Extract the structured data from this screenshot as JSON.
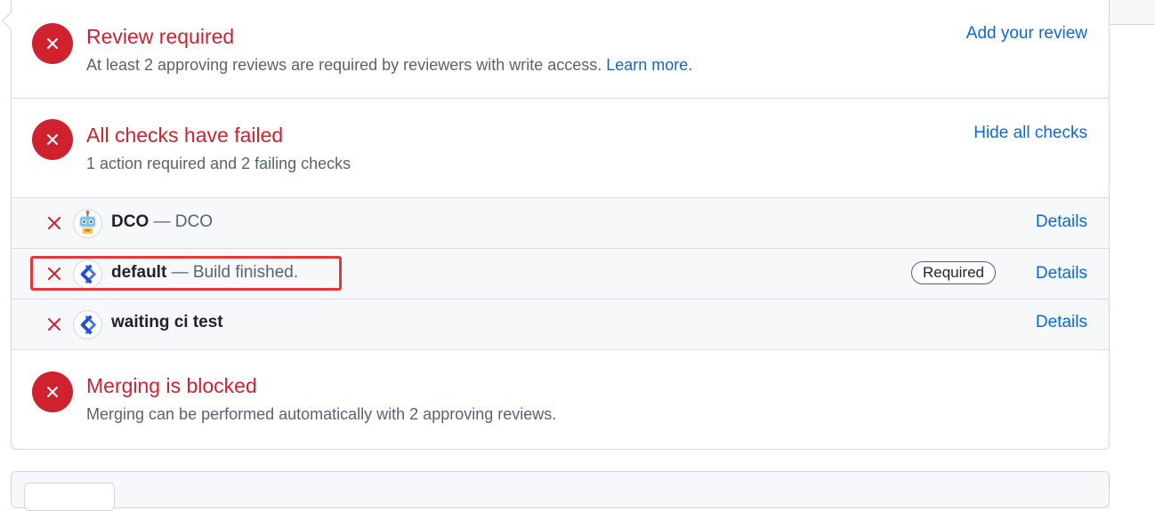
{
  "review": {
    "title": "Review required",
    "subtitle": "At least 2 approving reviews are required by reviewers with write access.",
    "learn_more": "Learn more.",
    "action": "Add your review"
  },
  "checks": {
    "title": "All checks have failed",
    "subtitle": "1 action required and 2 failing checks",
    "action": "Hide all checks",
    "items": [
      {
        "name": "DCO",
        "description": "— DCO",
        "details": "Details",
        "icon": "robot-icon"
      },
      {
        "name": "default",
        "description": "— Build finished.",
        "badge": "Required",
        "details": "Details",
        "icon": "ci-logo-icon",
        "highlighted": true
      },
      {
        "name": "waiting ci test",
        "description": "",
        "details": "Details",
        "icon": "ci-logo-icon"
      }
    ]
  },
  "merge": {
    "title": "Merging is blocked",
    "subtitle": "Merging can be performed automatically with 2 approving reviews."
  },
  "colors": {
    "danger": "#cf222e",
    "link": "#0969da",
    "highlight": "#e5383b",
    "muted": "#59636e"
  }
}
